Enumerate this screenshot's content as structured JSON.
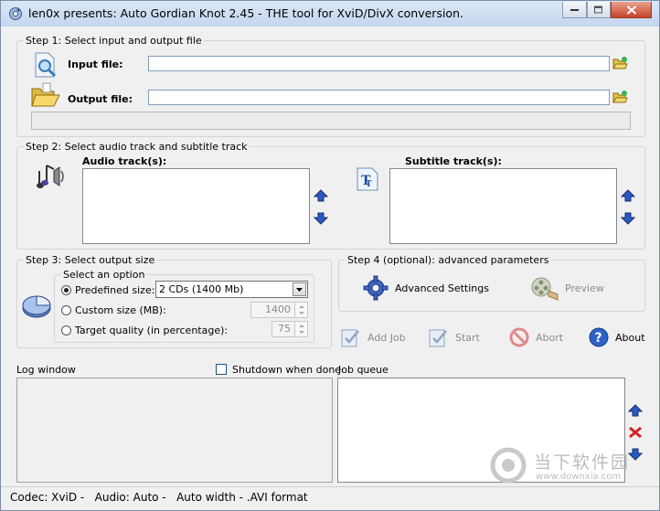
{
  "window": {
    "title": "len0x presents: Auto Gordian Knot 2.45 - THE tool for XviD/DivX conversion."
  },
  "step1": {
    "label": "Step 1: Select input and output file",
    "input_file_label": "Input file:",
    "input_file_value": "",
    "output_file_label": "Output file:",
    "output_file_value": ""
  },
  "step2": {
    "label": "Step 2: Select audio track and subtitle track",
    "audio_label": "Audio track(s):",
    "subtitle_label": "Subtitle track(s):"
  },
  "step3": {
    "label": "Step 3: Select output size",
    "option_label": "Select an option",
    "predefined_label": "Predefined size:",
    "predefined_value": "2 CDs (1400 Mb)",
    "custom_label": "Custom size (MB):",
    "custom_value": "1400",
    "quality_label": "Target quality (in percentage):",
    "quality_value": "75",
    "selected_option": "predefined"
  },
  "step4": {
    "label": "Step 4 (optional): advanced parameters",
    "advanced_label": "Advanced Settings",
    "preview_label": "Preview"
  },
  "actions": {
    "add_job": "Add Job",
    "start": "Start",
    "abort": "Abort",
    "about": "About"
  },
  "log": {
    "label": "Log window",
    "shutdown_label": "Shutdown when done",
    "shutdown_checked": false
  },
  "queue": {
    "label": "Job queue"
  },
  "status": {
    "text": "Codec: XviD -   Audio: Auto -   Auto width - .AVI format"
  },
  "watermark": {
    "text": "当下软件园",
    "url": "www.downxia.com"
  },
  "colors": {
    "accent_blue": "#2b59c3",
    "delete_red": "#d42020"
  }
}
